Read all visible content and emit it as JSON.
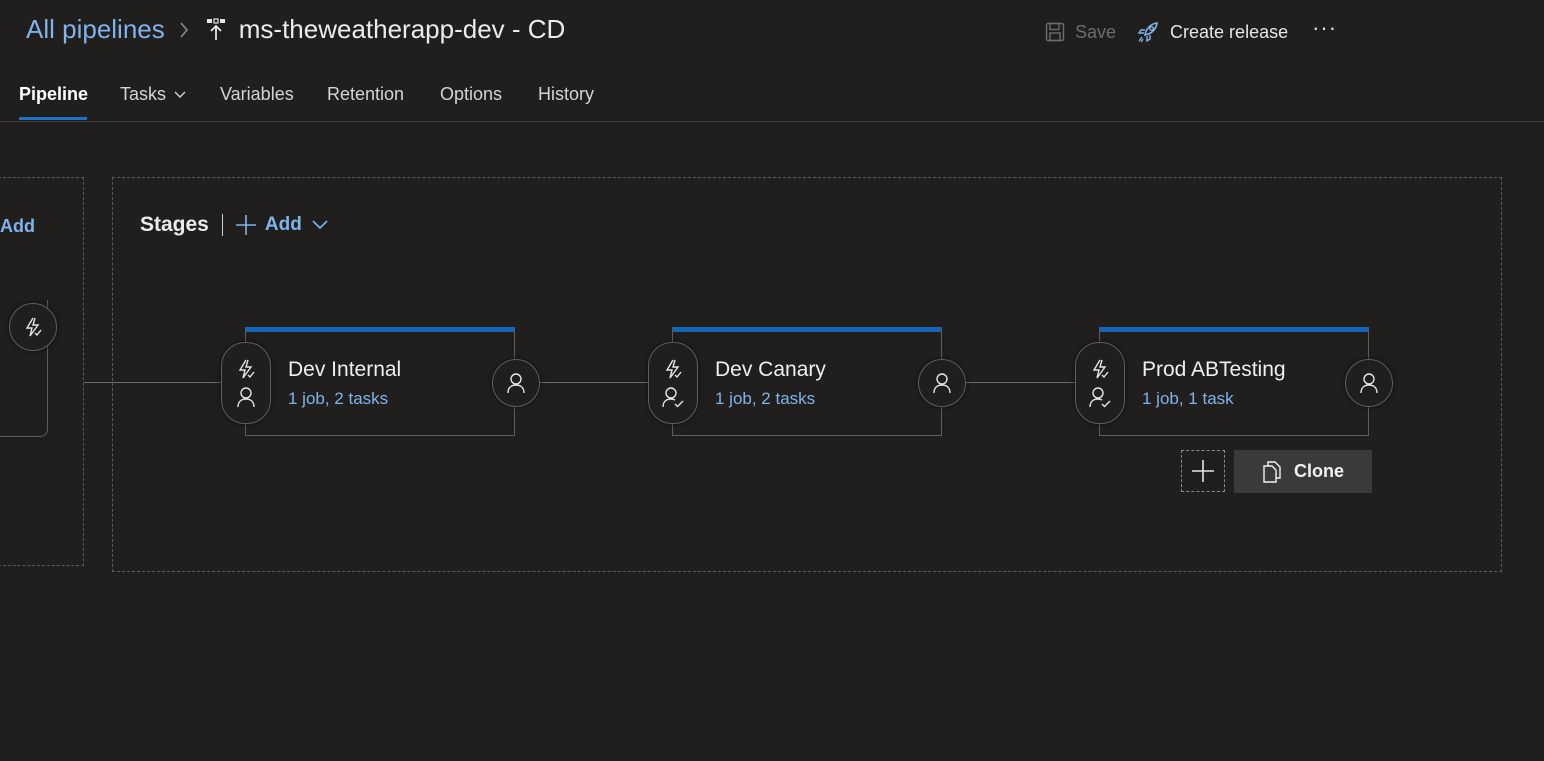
{
  "header": {
    "breadcrumb_root": "All pipelines",
    "pipeline_name": "ms-theweatherapp-dev - CD",
    "save_label": "Save",
    "create_release_label": "Create release",
    "more_label": "···"
  },
  "tabs": [
    {
      "label": "Pipeline",
      "active": true
    },
    {
      "label": "Tasks",
      "has_dropdown": true
    },
    {
      "label": "Variables"
    },
    {
      "label": "Retention"
    },
    {
      "label": "Options"
    },
    {
      "label": "History"
    }
  ],
  "artifacts": {
    "add_label": "Add"
  },
  "stages": {
    "title": "Stages",
    "add_label": "Add",
    "items": [
      {
        "name": "Dev Internal",
        "summary": "1 job, 2 tasks",
        "pre_approval_icon": "person-icon"
      },
      {
        "name": "Dev Canary",
        "summary": "1 job, 2 tasks",
        "pre_approval_icon": "person-check-icon"
      },
      {
        "name": "Prod ABTesting",
        "summary": "1 job, 1 task",
        "pre_approval_icon": "person-check-icon"
      }
    ]
  },
  "stage_actions": {
    "clone_label": "Clone"
  },
  "colors": {
    "background": "#201f1e",
    "accent": "#1565b8",
    "link": "#7fb3ea"
  }
}
